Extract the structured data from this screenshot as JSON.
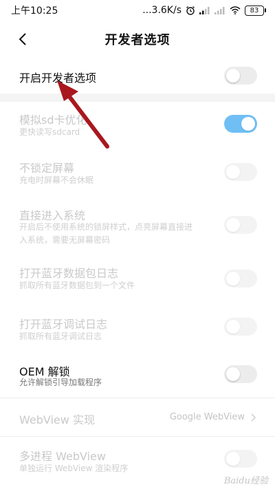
{
  "status_bar": {
    "time": "上午10:25",
    "network_speed": "...3.6K/s",
    "battery": "83"
  },
  "header": {
    "title": "开发者选项"
  },
  "settings": [
    {
      "title": "开启开发者选项",
      "subtitle": "",
      "toggle": "off",
      "enabled": true
    },
    {
      "title": "模拟sd卡优化",
      "subtitle": "更快读写sdcard",
      "toggle": "on",
      "enabled": false
    },
    {
      "title": "不锁定屏幕",
      "subtitle": "充电时屏幕不会休眠",
      "toggle": "off",
      "enabled": false
    },
    {
      "title": "直接进入系统",
      "subtitle_line1": "开启后不使用系统的锁屏样式，点亮屏幕直接进",
      "subtitle_line2": "入系统，需要无屏幕密码",
      "toggle": "off",
      "enabled": false
    },
    {
      "title": "打开蓝牙数据包日志",
      "subtitle": "抓取所有蓝牙数据包到一个文件",
      "toggle": "off",
      "enabled": false
    },
    {
      "title": "打开蓝牙调试日志",
      "subtitle": "抓取所有蓝牙调试日志",
      "toggle": "off",
      "enabled": false
    },
    {
      "title": "OEM 解锁",
      "subtitle": "允许解锁引导加载程序",
      "toggle": "off",
      "enabled": true
    },
    {
      "title": "WebView 实现",
      "value": "Google WebView",
      "enabled": false
    },
    {
      "title": "多进程 WebView",
      "subtitle": "单独运行 WebView 渲染程序",
      "toggle": "off",
      "enabled": false
    }
  ],
  "watermark": "Baidu经验",
  "colors": {
    "toggle_on": "#6fbff5",
    "arrow": "#a8181e"
  }
}
